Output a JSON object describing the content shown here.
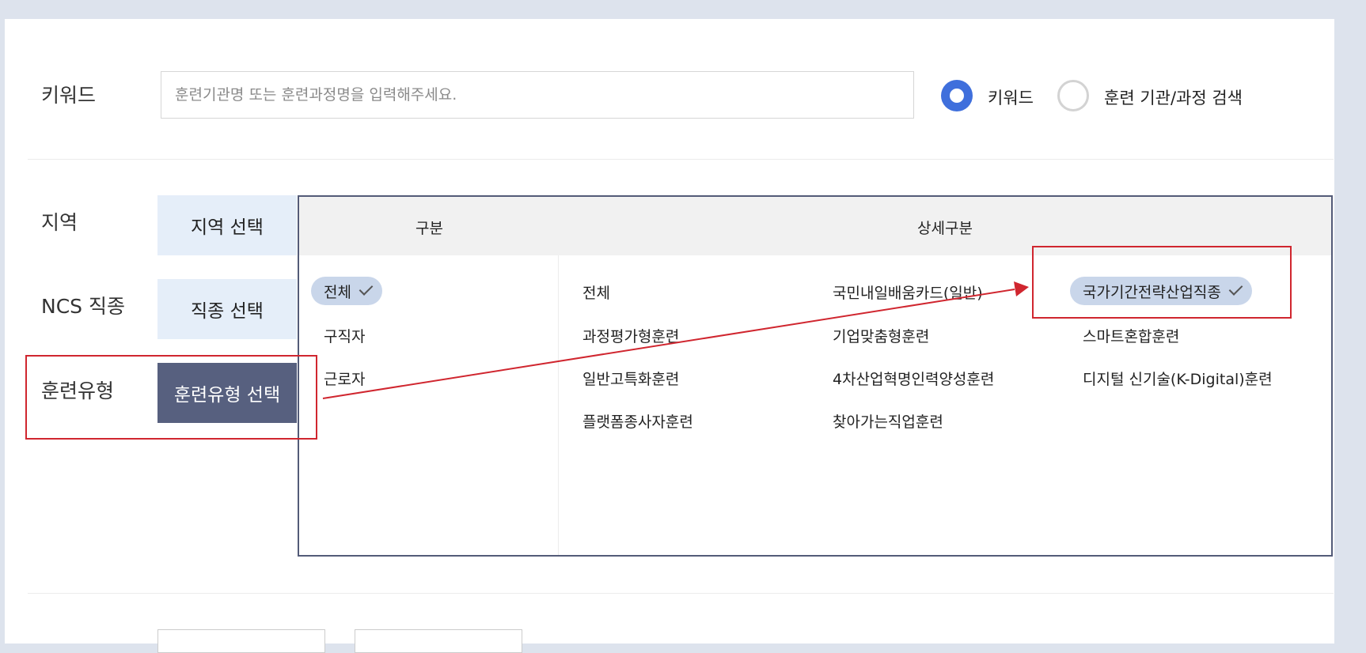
{
  "search": {
    "label": "키워드",
    "placeholder": "훈련기관명 또는 훈련과정명을 입력해주세요.",
    "value": "",
    "radio_options": [
      {
        "label": "키워드",
        "selected": true
      },
      {
        "label": "훈련 기관/과정 검색",
        "selected": false
      }
    ]
  },
  "filters": {
    "region": {
      "label": "지역",
      "button": "지역 선택"
    },
    "ncs": {
      "label": "NCS 직종",
      "button": "직종 선택"
    },
    "training_type": {
      "label": "훈련유형",
      "button": "훈련유형 선택",
      "active": true
    }
  },
  "dropdown": {
    "header_category": "구분",
    "header_detail": "상세구분",
    "categories": [
      {
        "label": "전체",
        "selected": true
      },
      {
        "label": "구직자",
        "selected": false
      },
      {
        "label": "근로자",
        "selected": false
      }
    ],
    "details": [
      {
        "label": "전체",
        "selected": false
      },
      {
        "label": "국민내일배움카드(일반)",
        "selected": false
      },
      {
        "label": "국가기간전략산업직종",
        "selected": true
      },
      {
        "label": "과정평가형훈련",
        "selected": false
      },
      {
        "label": "기업맞춤형훈련",
        "selected": false
      },
      {
        "label": "스마트혼합훈련",
        "selected": false
      },
      {
        "label": "일반고특화훈련",
        "selected": false
      },
      {
        "label": "4차산업혁명인력양성훈련",
        "selected": false
      },
      {
        "label": "디지털 신기술(K-Digital)훈련",
        "selected": false
      },
      {
        "label": "플랫폼종사자훈련",
        "selected": false
      },
      {
        "label": "찾아가는직업훈련",
        "selected": false
      }
    ]
  },
  "colors": {
    "accent_blue": "#3f6fdc",
    "active_button": "#57607f",
    "inactive_button": "#e5eef9",
    "chip": "#c9d6ea",
    "annotation_red": "#d0262f",
    "dropdown_border": "#535b78"
  }
}
